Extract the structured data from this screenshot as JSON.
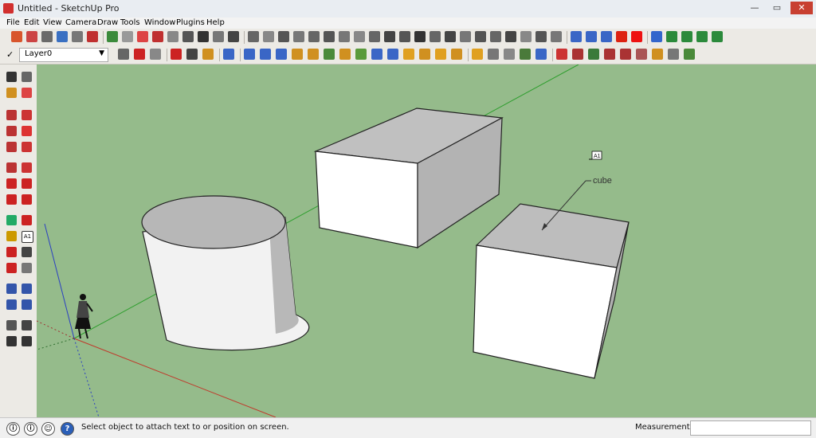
{
  "window": {
    "title": "Untitled - SketchUp Pro",
    "minimize": "—",
    "maximize": "▭",
    "close": "✕"
  },
  "menu": {
    "items": [
      "File",
      "Edit",
      "View",
      "Camera",
      "Draw",
      "Tools",
      "Window",
      "Plugins",
      "Help"
    ]
  },
  "layers": {
    "check": "✓",
    "current": "Layer0",
    "arrow": "▼"
  },
  "toolbar_top": {
    "icon_colors": [
      "#d8552c",
      "#c44",
      "#6a6a6a",
      "#3a70c2",
      "#777",
      "#c03030",
      "#3b8a3b",
      "#999",
      "#d44",
      "#c03030",
      "#888",
      "#555",
      "#333",
      "#777",
      "#444",
      "#666",
      "#888",
      "#555",
      "#777",
      "#666",
      "#555",
      "#777",
      "#888",
      "#666",
      "#444",
      "#555",
      "#333",
      "#666",
      "#444",
      "#777",
      "#555",
      "#666",
      "#444",
      "#888",
      "#555",
      "#777",
      "#3a66c6",
      "#3a66c6",
      "#3a66c6",
      "#d21",
      "#e11",
      "#3366cc",
      "#2b8a3b",
      "#2b8a3b",
      "#2b8a3b",
      "#2b8a3b"
    ]
  },
  "toolbar_bottom": {
    "icon_colors": [
      "#666",
      "#c22",
      "#888",
      "#c22",
      "#444",
      "#d09020",
      "#3a66c6",
      "#3a66c6",
      "#3a66c6",
      "#3a66c6",
      "#d09020",
      "#d09020",
      "#4a8a3a",
      "#d09020",
      "#5a9a3a",
      "#3a66c6",
      "#3a66c6",
      "#e0a020",
      "#d09020",
      "#e0a020",
      "#d09020",
      "#e0a020",
      "#777",
      "#888",
      "#4a7a3a",
      "#3a66c6",
      "#c33",
      "#a33",
      "#3a7a3a",
      "#a33",
      "#a33",
      "#a55",
      "#d09020",
      "#777",
      "#4a8a3a"
    ]
  },
  "left_toolbar": {
    "icon_colors": [
      "#333",
      "#666",
      "#d09020",
      "#d44",
      "#b33",
      "#c33",
      "#b33",
      "#d33",
      "#b33",
      "#c33",
      "#b33",
      "#c33",
      "#c22",
      "#c22",
      "#c22",
      "#c22",
      "#2a6",
      "#c22",
      "#c90",
      "#555",
      "#c22",
      "#444",
      "#c22",
      "#777",
      "#35a",
      "#35a",
      "#35a",
      "#35a",
      "#555",
      "#444",
      "#333",
      "#333"
    ],
    "text_tool_label": "A1"
  },
  "viewport": {
    "background": "#95bb8b",
    "leader_text": "cube",
    "text_cursor_label": "A1",
    "axis_colors": {
      "red": "#c0392b",
      "green": "#2e9e2e",
      "blue": "#2a3fc2"
    }
  },
  "statusbar": {
    "icons": [
      "ⓘ",
      "ⓘ",
      "☺",
      "?"
    ],
    "message": "Select object to attach text to or position on screen.",
    "measurements_label": "Measurements",
    "measurements_value": ""
  }
}
